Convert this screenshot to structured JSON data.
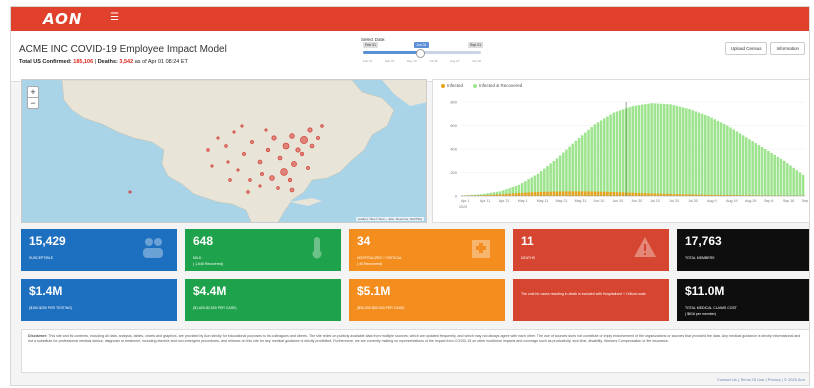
{
  "brand": {
    "logo": "AON",
    "menu_icon": "hamburger-icon"
  },
  "header": {
    "title": "ACME INC COVID-19 Employee Impact Model",
    "confirmed_label": "Total US Confirmed:",
    "confirmed_value": "185,106",
    "deaths_label": "Deaths:",
    "deaths_value": "3,542",
    "as_of": "as of Apr 01 08:24 ET"
  },
  "date_select": {
    "label": "Select Date:",
    "start_tag": "Feb 01",
    "selected_tag": "Jun 01",
    "end_tag": "Sep 01",
    "selected_fraction": 0.48,
    "ticks": [
      "Feb 01",
      "Mar 24",
      "May 15",
      "Jul 06",
      "Aug 27",
      "Oct 18"
    ]
  },
  "buttons": {
    "upload": "Upload Census",
    "information": "Information"
  },
  "map": {
    "zoom_in": "+",
    "zoom_out": "−",
    "attribution": "Leaflet | Tiles © Esri — Esri, DeLorme, NAVTEQ"
  },
  "chart_data": {
    "type": "bar",
    "legend": [
      "Infected",
      "Infected & Recovered"
    ],
    "categories": [
      "Apr 1",
      "Apr 11",
      "Apr 21",
      "May 1",
      "May 11",
      "May 21",
      "May 31",
      "Jun 10",
      "Jun 20",
      "Jun 30",
      "Jul 10",
      "Jul 20",
      "Jul 30",
      "Aug 9",
      "Aug 19",
      "Aug 29",
      "Sep 8",
      "Sep 18",
      "Sep 28"
    ],
    "xlabel_year": "2020",
    "yticks": [
      "800",
      "600",
      "400",
      "200",
      "0"
    ],
    "ylim": [
      0,
      800
    ],
    "series": [
      {
        "name": "Infected & Recovered",
        "color": "#9ee48f",
        "values": [
          5,
          15,
          40,
          95,
          190,
          320,
          470,
          610,
          710,
          765,
          790,
          780,
          740,
          680,
          600,
          500,
          400,
          300,
          180
        ]
      },
      {
        "name": "Infected",
        "color": "#e8a31c",
        "values": [
          2,
          6,
          14,
          26,
          34,
          38,
          40,
          38,
          34,
          28,
          22,
          18,
          14,
          10,
          8,
          6,
          4,
          3,
          2
        ]
      }
    ]
  },
  "tiles": [
    {
      "value": "15,429",
      "label": "Susceptible",
      "note": "",
      "color": "blue",
      "icon": "people-icon"
    },
    {
      "value": "648",
      "label": "Mild",
      "note": "( 1,646 Recovered)",
      "color": "green",
      "icon": "thermometer-icon"
    },
    {
      "value": "34",
      "label": "Hospitalized + Critical",
      "note": "( 45 Recovered)",
      "color": "orange",
      "icon": "hospital-icon"
    },
    {
      "value": "11",
      "label": "Deaths",
      "note": "",
      "color": "crimson",
      "icon": "warning-icon"
    },
    {
      "value": "17,763",
      "label": "Total Members",
      "note": "",
      "color": "black",
      "icon": ""
    },
    {
      "value": "$1.4M",
      "label": "($150-$250 per testing)",
      "note": "",
      "color": "blue",
      "icon": ""
    },
    {
      "value": "$4.4M",
      "label": "($1,600-$2,500 per case)",
      "note": "",
      "color": "green",
      "icon": ""
    },
    {
      "value": "$5.1M",
      "label": "($30,000-$50,000 per case)",
      "note": "",
      "color": "orange",
      "icon": ""
    },
    {
      "value": "",
      "label": "",
      "note": "The cost for cases resulting in death is included with Hospitalized + Critical costs",
      "color": "crimson",
      "icon": ""
    },
    {
      "value": "$11.0M",
      "label": "Total Medical Claims Cost",
      "note": "( $616 per member)",
      "color": "black",
      "icon": ""
    }
  ],
  "disclaimer": {
    "heading": "Disclaimer:",
    "text": "This site and its contents, including all data, analysis, tables, charts and graphics, are provided by Aon strictly for educational purposes to its colleagues and clients. The site relies on publicly available data from multiple sources, which are updated frequently, and which may not always agree with each other. The use of sources does not constitute or imply endorsement of the organizations or sources that provided the data. Any medical guidance is strictly informational and not a substitute for professional medical advice, diagnosis or treatment, including elective and non-emergent procedures, and reliance on this site for any medical guidance is strictly prohibited. Furthermore, we are currently making no representations of the impact from COVID-19 on other workforce impacts and coverage such as productivity, sick time, disability, Workers Compensation or life insurance."
  },
  "footer": {
    "links": "Contact Us | Terms Of Use | Privacy | © 2020 Aon"
  }
}
